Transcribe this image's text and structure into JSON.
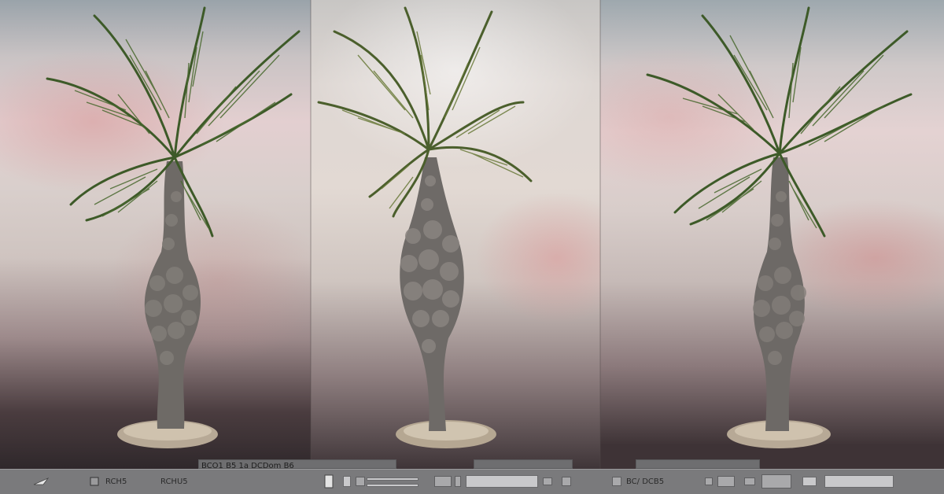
{
  "toolbar": {
    "label_top": "BCO1 B5   1a DCDom B6",
    "label_a": "RCH5",
    "label_b": "RCHU5",
    "label_c": "BC/ DCB5"
  },
  "icons": {
    "cursor": "pointer-icon",
    "panel": "panel-icon",
    "doc": "document-icon",
    "settings": "settings-icon"
  },
  "colors": {
    "toolbar": "#7a7a7c",
    "frond": "#3f5a2a",
    "trunk": "#6b6663"
  }
}
